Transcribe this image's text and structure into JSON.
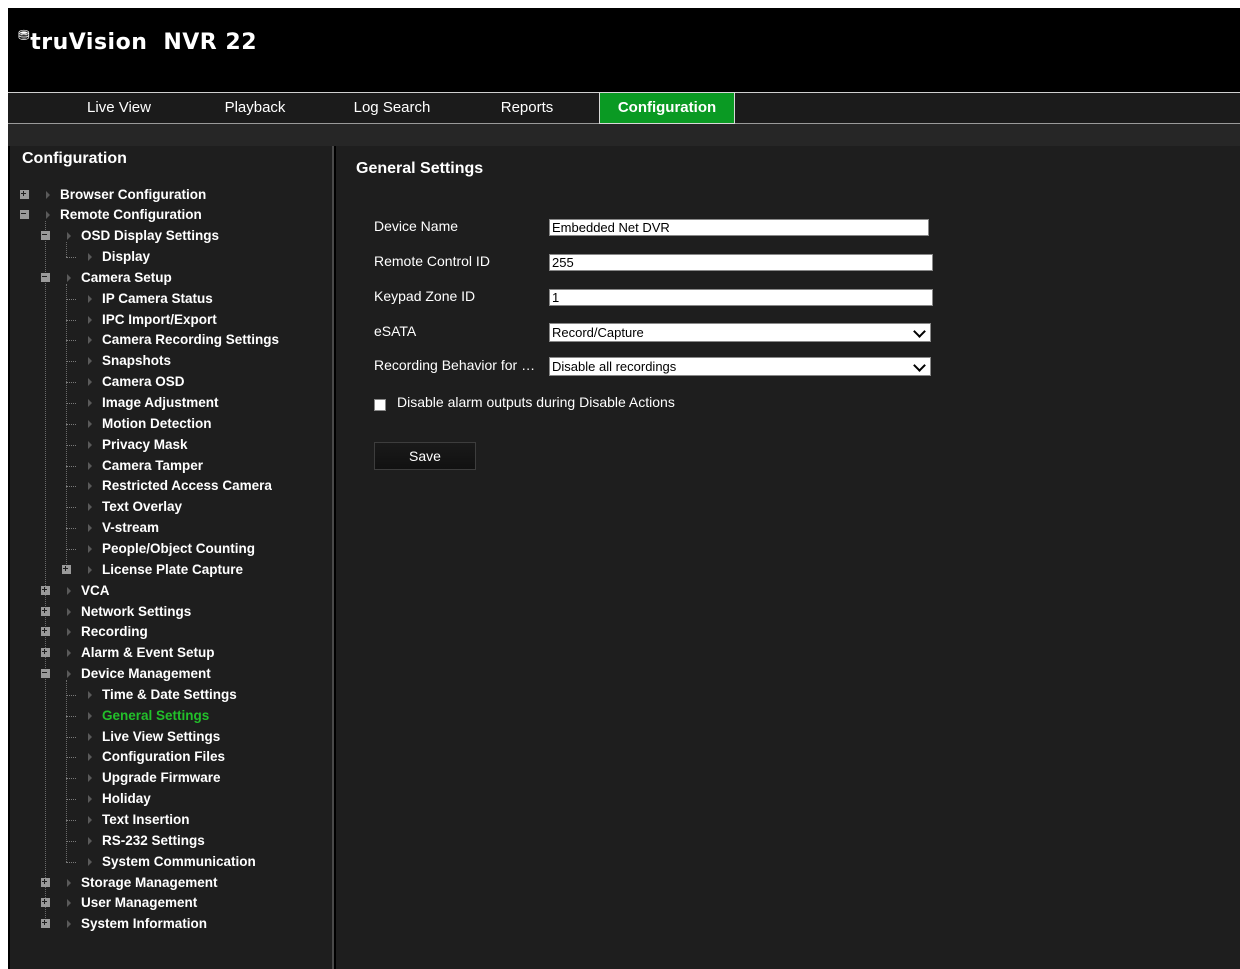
{
  "app": {
    "logo_mark": "⛃",
    "brand": "truVision",
    "product": "NVR 22"
  },
  "nav": {
    "tabs": [
      {
        "label": "Live View"
      },
      {
        "label": "Playback"
      },
      {
        "label": "Log Search"
      },
      {
        "label": "Reports"
      },
      {
        "label": "Configuration",
        "active": true
      }
    ]
  },
  "sidebar": {
    "title": "Configuration",
    "items": [
      {
        "label": "Browser Configuration",
        "level": 0,
        "toggle": "plus"
      },
      {
        "label": "Remote Configuration",
        "level": 0,
        "toggle": "minus"
      },
      {
        "label": "OSD Display Settings",
        "level": 1,
        "toggle": "minus"
      },
      {
        "label": "Display",
        "level": 2
      },
      {
        "label": "Camera Setup",
        "level": 1,
        "toggle": "minus"
      },
      {
        "label": "IP Camera Status",
        "level": 2
      },
      {
        "label": "IPC Import/Export",
        "level": 2
      },
      {
        "label": "Camera Recording Settings",
        "level": 2
      },
      {
        "label": "Snapshots",
        "level": 2
      },
      {
        "label": "Camera OSD",
        "level": 2
      },
      {
        "label": "Image Adjustment",
        "level": 2
      },
      {
        "label": "Motion Detection",
        "level": 2
      },
      {
        "label": "Privacy Mask",
        "level": 2
      },
      {
        "label": "Camera Tamper",
        "level": 2
      },
      {
        "label": "Restricted Access Camera",
        "level": 2
      },
      {
        "label": "Text Overlay",
        "level": 2
      },
      {
        "label": "V-stream",
        "level": 2
      },
      {
        "label": "People/Object Counting",
        "level": 2
      },
      {
        "label": "License Plate Capture",
        "level": 2,
        "toggle": "plus"
      },
      {
        "label": "VCA",
        "level": 1,
        "toggle": "plus"
      },
      {
        "label": "Network Settings",
        "level": 1,
        "toggle": "plus"
      },
      {
        "label": "Recording",
        "level": 1,
        "toggle": "plus"
      },
      {
        "label": "Alarm & Event Setup",
        "level": 1,
        "toggle": "plus"
      },
      {
        "label": "Device Management",
        "level": 1,
        "toggle": "minus"
      },
      {
        "label": "Time & Date Settings",
        "level": 2
      },
      {
        "label": "General Settings",
        "level": 2,
        "active": true
      },
      {
        "label": "Live View Settings",
        "level": 2
      },
      {
        "label": "Configuration Files",
        "level": 2
      },
      {
        "label": "Upgrade Firmware",
        "level": 2
      },
      {
        "label": "Holiday",
        "level": 2
      },
      {
        "label": "Text Insertion",
        "level": 2
      },
      {
        "label": "RS-232 Settings",
        "level": 2
      },
      {
        "label": "System Communication",
        "level": 2
      },
      {
        "label": "Storage Management",
        "level": 1,
        "toggle": "plus"
      },
      {
        "label": "User Management",
        "level": 1,
        "toggle": "plus"
      },
      {
        "label": "System Information",
        "level": 1,
        "toggle": "plus"
      }
    ]
  },
  "main": {
    "title": "General Settings",
    "fields": {
      "device_name": {
        "label": "Device Name",
        "value": "Embedded Net DVR"
      },
      "remote_control_id": {
        "label": "Remote Control ID",
        "value": "255"
      },
      "keypad_zone_id": {
        "label": "Keypad Zone ID",
        "value": "1"
      },
      "esata": {
        "label": "eSATA",
        "value": "Record/Capture"
      },
      "recording_behavior": {
        "label": "Recording Behavior for Di...",
        "value": "Disable all recordings"
      }
    },
    "checkbox": {
      "label": "Disable alarm outputs during Disable Actions",
      "checked": false
    },
    "save_label": "Save"
  }
}
